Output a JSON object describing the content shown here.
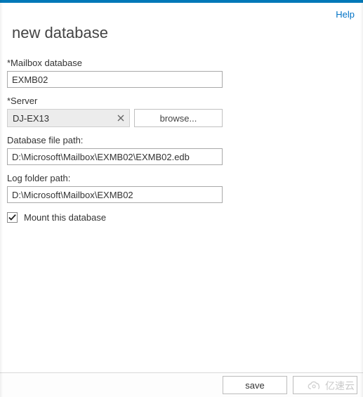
{
  "header": {
    "help_label": "Help",
    "title": "new database"
  },
  "form": {
    "mailbox_db": {
      "label": "*Mailbox database",
      "value": "EXMB02"
    },
    "server": {
      "label": "*Server",
      "value": "DJ-EX13",
      "browse_label": "browse..."
    },
    "db_file_path": {
      "label": "Database file path:",
      "value": "D:\\Microsoft\\Mailbox\\EXMB02\\EXMB02.edb"
    },
    "log_folder_path": {
      "label": "Log folder path:",
      "value": "D:\\Microsoft\\Mailbox\\EXMB02"
    },
    "mount_checkbox": {
      "label": "Mount this database",
      "checked": true
    }
  },
  "footer": {
    "save_label": "save",
    "cancel_label": ""
  },
  "watermark": {
    "text": "亿速云"
  }
}
